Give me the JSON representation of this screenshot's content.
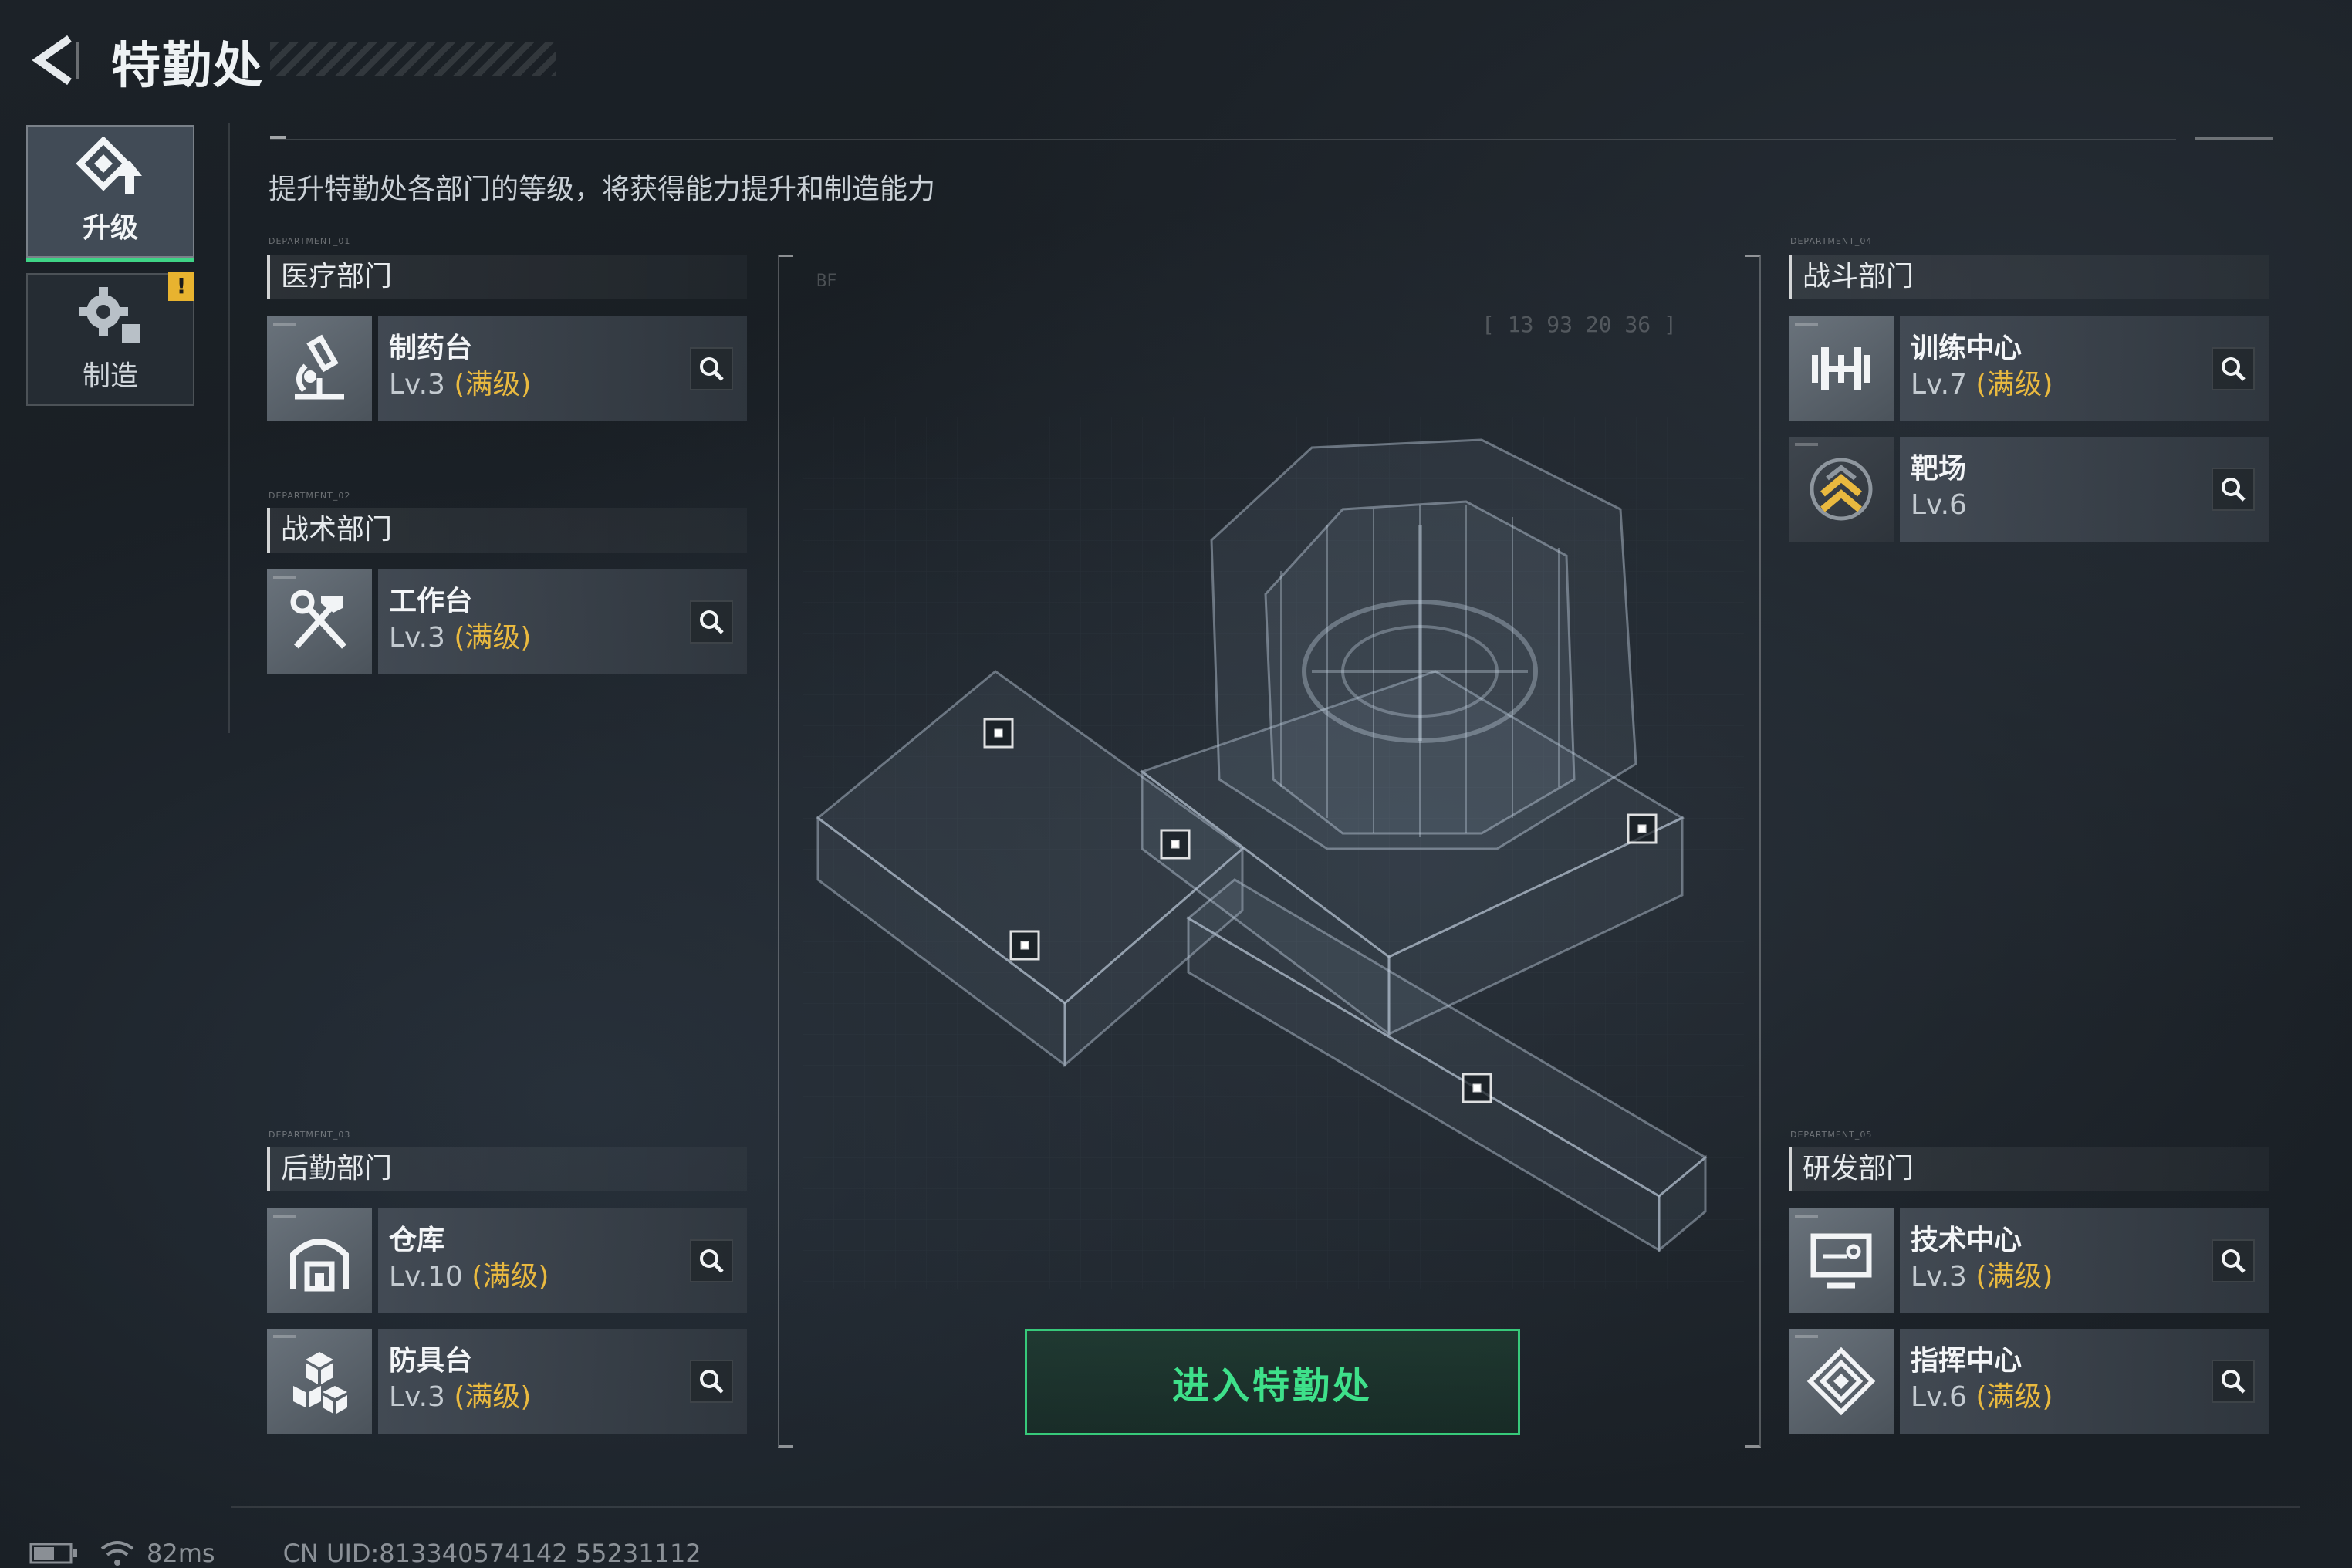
{
  "header": {
    "title": "特勤处",
    "subtitle": "提升特勤处各部门的等级，将获得能力提升和制造能力"
  },
  "tabs": [
    {
      "label": "升级",
      "icon": "upgrade-icon",
      "active": true
    },
    {
      "label": "制造",
      "icon": "gear-icon",
      "alert": "!"
    }
  ],
  "departments": {
    "medical": {
      "tag": "DEPARTMENT_01",
      "title": "医疗部门",
      "items": [
        {
          "name": "制药台",
          "level": "Lv.3",
          "max": "(满级)",
          "icon": "microscope-icon"
        }
      ]
    },
    "tactical": {
      "tag": "DEPARTMENT_02",
      "title": "战术部门",
      "items": [
        {
          "name": "工作台",
          "level": "Lv.3",
          "max": "(满级)",
          "icon": "hammer-wrench-icon"
        }
      ]
    },
    "logistics": {
      "tag": "DEPARTMENT_03",
      "title": "后勤部门",
      "items": [
        {
          "name": "仓库",
          "level": "Lv.10",
          "max": "(满级)",
          "icon": "warehouse-icon"
        },
        {
          "name": "防具台",
          "level": "Lv.3",
          "max": "(满级)",
          "icon": "cubes-icon"
        }
      ]
    },
    "combat": {
      "tag": "DEPARTMENT_04",
      "title": "战斗部门",
      "items": [
        {
          "name": "训练中心",
          "level": "Lv.7",
          "max": "(满级)",
          "icon": "dumbbell-icon"
        },
        {
          "name": "靶场",
          "level": "Lv.6",
          "max": "",
          "icon": "rank-chevron-icon"
        }
      ]
    },
    "research": {
      "tag": "DEPARTMENT_05",
      "title": "研发部门",
      "items": [
        {
          "name": "技术中心",
          "level": "Lv.3",
          "max": "(满级)",
          "icon": "monitor-icon"
        },
        {
          "name": "指挥中心",
          "level": "Lv.6",
          "max": "(满级)",
          "icon": "command-diamond-icon"
        }
      ]
    }
  },
  "center": {
    "floor_label": "BF",
    "coords": "[ 13 93   20 36 ]",
    "enter_label": "进入特勤处"
  },
  "status": {
    "ping": "82ms",
    "uid": "CN UID:813340574142 55231112"
  },
  "colors": {
    "accent_green": "#3ee08a",
    "max_gold": "#e9b93f",
    "alert_yellow": "#e8b32f"
  }
}
